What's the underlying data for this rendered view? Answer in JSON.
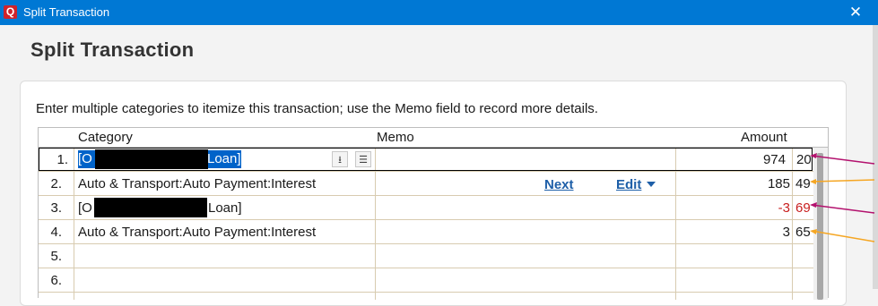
{
  "window": {
    "title": "Split Transaction",
    "app_icon": "Q",
    "close": "✕"
  },
  "dialog": {
    "heading": "Split Transaction",
    "instructions": "Enter multiple categories to itemize this transaction; use the Memo field to record more details."
  },
  "grid": {
    "headers": {
      "category": "Category",
      "memo": "Memo",
      "amount": "Amount"
    },
    "rows": [
      {
        "num": "1.",
        "category_prefix": "[O",
        "category_suffix": "Loan]",
        "memo": "",
        "amount_whole": "974",
        "amount_cents": "20",
        "negative": false,
        "selected": true
      },
      {
        "num": "2.",
        "category": "Auto & Transport:Auto Payment:Interest",
        "memo": "",
        "amount_whole": "185",
        "amount_cents": "49",
        "negative": false
      },
      {
        "num": "3.",
        "category_prefix": "[O",
        "category_suffix": "Loan]",
        "memo": "",
        "amount_whole": "-3",
        "amount_cents": "69",
        "negative": true
      },
      {
        "num": "4.",
        "category": "Auto & Transport:Auto Payment:Interest",
        "memo": "",
        "amount_whole": "3",
        "amount_cents": "65",
        "negative": false
      },
      {
        "num": "5."
      },
      {
        "num": "6."
      }
    ],
    "row_actions": {
      "next": "Next",
      "edit": "Edit"
    }
  },
  "colors": {
    "titlebar": "#0078d4",
    "selection": "#0063c9",
    "negative": "#c81e1e",
    "link": "#1e5fa8",
    "arrow_magenta": "#b3126e",
    "arrow_orange": "#f5a623"
  }
}
